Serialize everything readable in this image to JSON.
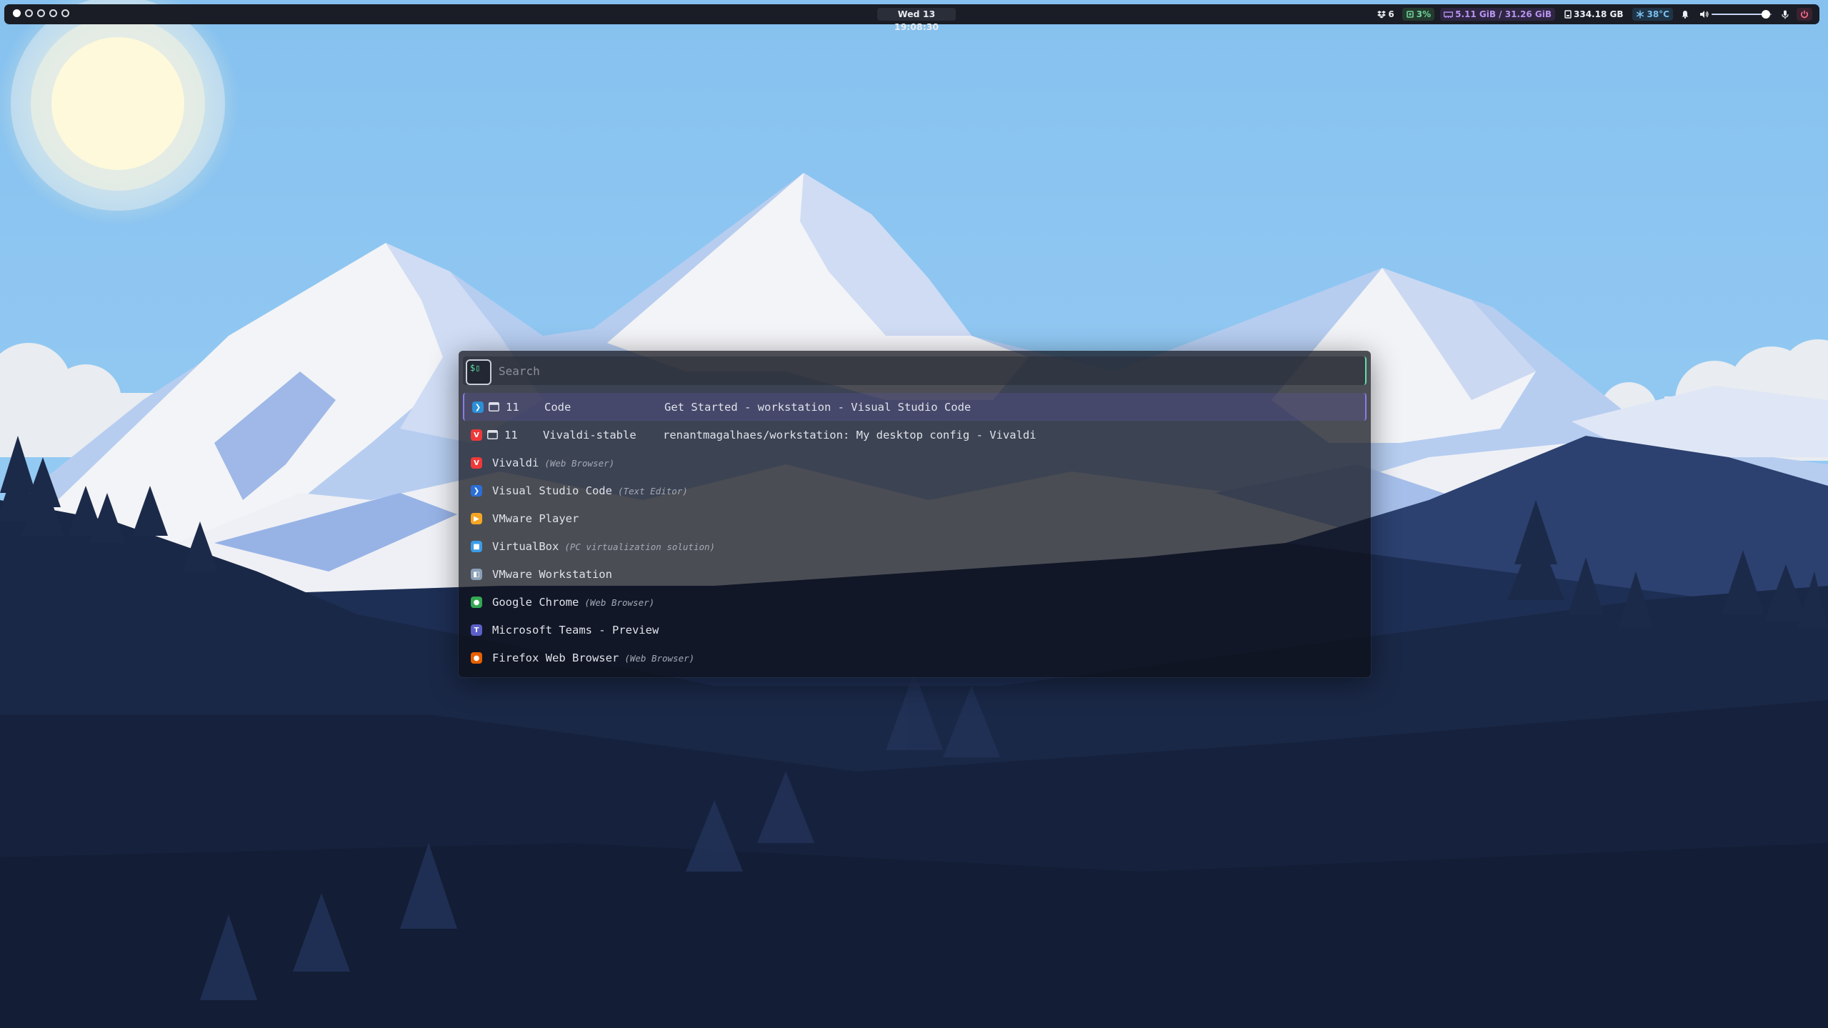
{
  "topbar": {
    "workspaces": [
      {
        "active": true
      },
      {
        "active": false
      },
      {
        "active": false
      },
      {
        "active": false
      },
      {
        "active": false
      }
    ],
    "clock": "Wed 13 19:08:30",
    "dropbox": {
      "icon": "dropbox-icon",
      "count": "6"
    },
    "cpu": {
      "icon": "cpu-icon",
      "value": "3%",
      "color": "#6fd39a"
    },
    "memory": {
      "icon": "memory-icon",
      "value": "5.11 GiB / 31.26 GiB",
      "color": "#b793f0"
    },
    "disk": {
      "icon": "disk-icon",
      "value": "334.18 GB"
    },
    "temperature": {
      "icon": "snowflake-icon",
      "value": "38°C",
      "color": "#79bff0"
    },
    "notifications": {
      "icon": "bell-icon"
    },
    "volume": {
      "icon": "speaker-icon",
      "level": 0.9
    },
    "microphone": {
      "icon": "microphone-icon"
    },
    "power": {
      "icon": "power-icon",
      "color": "#ff6f8f"
    }
  },
  "launcher": {
    "prompt_symbol": "$▯",
    "search": {
      "placeholder": "Search",
      "value": ""
    },
    "windows": [
      {
        "icon": "vscode-icon",
        "icon_color": "#2b8fd6",
        "workspace": "11",
        "class": "Code",
        "title": "Get Started - workstation - Visual Studio Code",
        "selected": true
      },
      {
        "icon": "vivaldi-icon",
        "icon_color": "#ef3939",
        "workspace": "11",
        "class": "Vivaldi-stable",
        "title": "renantmagalhaes/workstation: My desktop config - Vivaldi",
        "selected": false
      }
    ],
    "apps": [
      {
        "icon": "vivaldi-icon",
        "icon_color": "#ef3939",
        "name": "Vivaldi",
        "description": "(Web Browser)"
      },
      {
        "icon": "vscode-icon",
        "icon_color": "#2b6fd6",
        "name": "Visual Studio Code",
        "description": "(Text Editor)"
      },
      {
        "icon": "vmware-player-icon",
        "icon_color": "#f5a623",
        "name": "VMware Player",
        "description": ""
      },
      {
        "icon": "virtualbox-icon",
        "icon_color": "#3a9de8",
        "name": "VirtualBox",
        "description": "(PC virtualization solution)"
      },
      {
        "icon": "vmware-workstation-icon",
        "icon_color": "#8aa0b8",
        "name": "VMware Workstation",
        "description": ""
      },
      {
        "icon": "google-chrome-icon",
        "icon_color": "#34a853",
        "name": "Google Chrome",
        "description": "(Web Browser)"
      },
      {
        "icon": "microsoft-teams-icon",
        "icon_color": "#5b5fc7",
        "name": "Microsoft Teams - Preview",
        "description": ""
      },
      {
        "icon": "firefox-icon",
        "icon_color": "#e66000",
        "name": "Firefox Web Browser",
        "description": "(Web Browser)"
      }
    ]
  }
}
